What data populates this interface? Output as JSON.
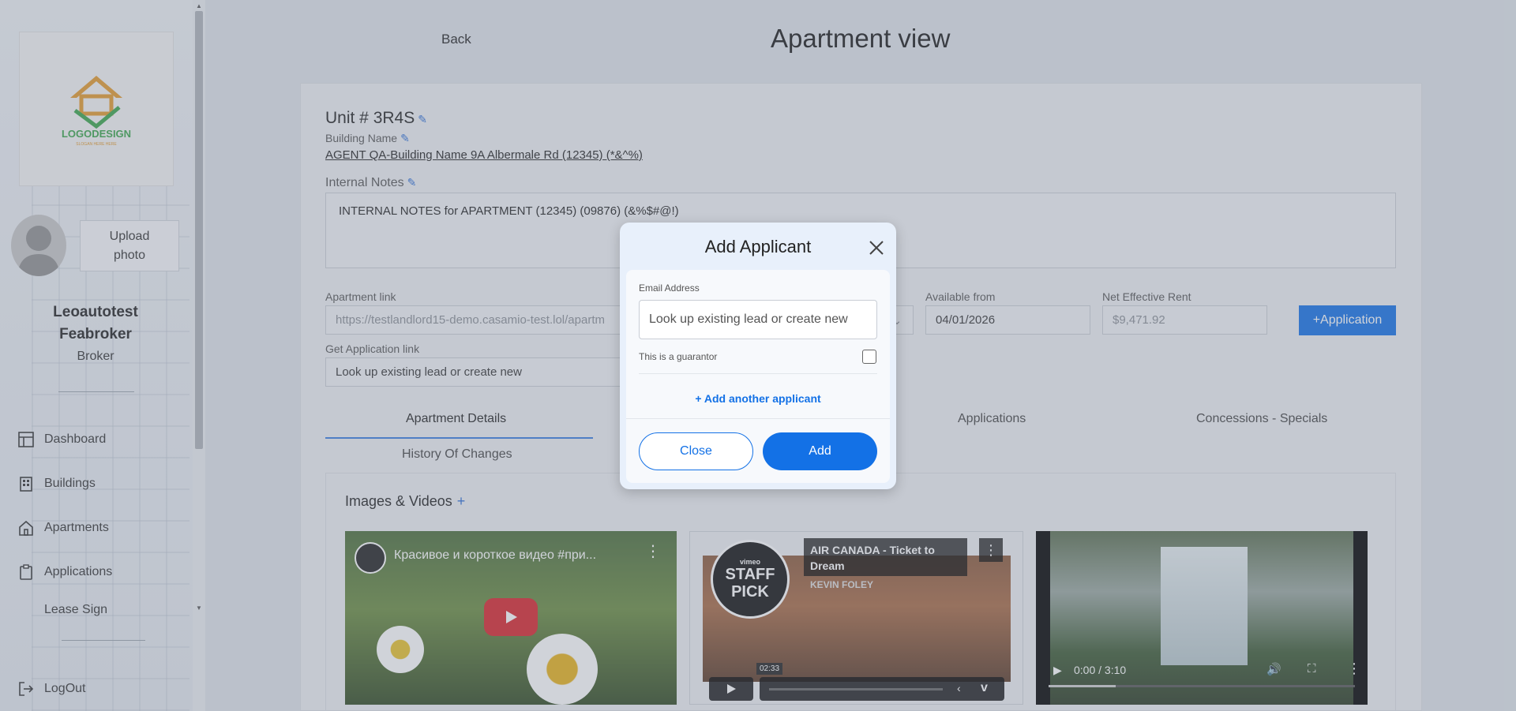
{
  "sidebar": {
    "logo_text": "LOGODESIGN",
    "logo_tagline": "SLOGAN HERE HERE",
    "upload_photo": "Upload\nphoto",
    "user_name": "Leoautotest\nFeabroker",
    "user_role": "Broker",
    "nav": [
      {
        "label": "Dashboard",
        "icon": "dashboard-icon"
      },
      {
        "label": "Buildings",
        "icon": "buildings-icon"
      },
      {
        "label": "Apartments",
        "icon": "home-icon"
      },
      {
        "label": "Applications",
        "icon": "clipboard-icon"
      },
      {
        "label": "Lease Sign",
        "icon": "document-icon"
      }
    ],
    "logout": "LogOut"
  },
  "header": {
    "back": "Back",
    "title": "Apartment view"
  },
  "unit": {
    "title": "Unit # 3R4S",
    "building_name_label": "Building Name",
    "building_link": "AGENT QA-Building Name 9A Albermale Rd (12345) (*&^%)",
    "internal_notes_label": "Internal Notes",
    "internal_notes": "INTERNAL NOTES for APARTMENT (12345) (09876) (&%$#@!)"
  },
  "fields": {
    "apartment_link_label": "Apartment link",
    "apartment_link_value": "https://testlandlord15-demo.casamio-test.lol/apartm",
    "get_app_link_label": "Get Application link",
    "get_app_link_placeholder": "Look up existing lead or create new",
    "available_from_label": "Available from",
    "available_from_value": "04/01/2026",
    "net_rent_label": "Net Effective Rent",
    "net_rent_value": "$9,471.92",
    "application_button": "+Application"
  },
  "tabs": {
    "apartment_details": "Apartment Details",
    "applications": "Applications",
    "concessions": "Concessions - Specials",
    "history": "History Of Changes"
  },
  "media": {
    "title": "Images & Videos",
    "plus": "+",
    "video1_title": "Красивое и короткое видео #при...",
    "video2_title": "AIR CANADA - Ticket to Dream",
    "video2_author": "KEVIN FOLEY",
    "video2_badge_top": "vimeo",
    "video2_badge": "STAFF PICK",
    "video2_time": "02:33",
    "video3_time": "0:00 / 3:10"
  },
  "modal": {
    "title": "Add Applicant",
    "email_label": "Email Address",
    "email_placeholder": "Look up existing lead or create new",
    "guarantor_label": "This is a guarantor",
    "add_another": "+ Add another applicant",
    "close": "Close",
    "add": "Add"
  },
  "colors": {
    "accent": "#1371e6"
  }
}
